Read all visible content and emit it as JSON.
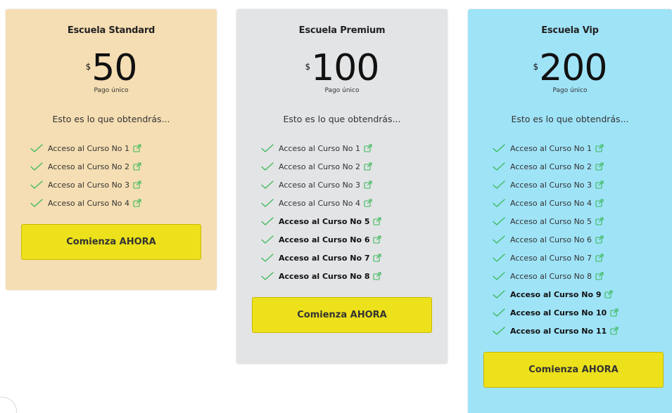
{
  "plans": [
    {
      "key": "standard",
      "title": "Escuela Standard",
      "currency": "$",
      "price": "50",
      "price_note": "Pago único",
      "subtitle": "Esto es lo que obtendrás...",
      "features": [
        {
          "label": "Acceso al Curso No 1",
          "bold": false
        },
        {
          "label": "Acceso al Curso No 2",
          "bold": false
        },
        {
          "label": "Acceso al Curso No 3",
          "bold": false
        },
        {
          "label": "Acceso al Curso No 4",
          "bold": false
        }
      ],
      "cta_label": "Comienza AHORA"
    },
    {
      "key": "premium",
      "title": "Escuela Premium",
      "currency": "$",
      "price": "100",
      "price_note": "Pago único",
      "subtitle": "Esto es lo que obtendrás...",
      "features": [
        {
          "label": "Acceso al Curso No 1",
          "bold": false
        },
        {
          "label": "Acceso al Curso No 2",
          "bold": false
        },
        {
          "label": "Acceso al Curso No 3",
          "bold": false
        },
        {
          "label": "Acceso al Curso No 4",
          "bold": false
        },
        {
          "label": "Acceso al Curso No 5",
          "bold": true
        },
        {
          "label": "Acceso al Curso No 6",
          "bold": true
        },
        {
          "label": "Acceso al Curso No 7",
          "bold": true
        },
        {
          "label": "Acceso al Curso No 8",
          "bold": true
        }
      ],
      "cta_label": "Comienza AHORA"
    },
    {
      "key": "vip",
      "title": "Escuela Vip",
      "currency": "$",
      "price": "200",
      "price_note": "Pago único",
      "subtitle": "Esto es lo que obtendrás...",
      "features": [
        {
          "label": "Acceso al Curso No 1",
          "bold": false
        },
        {
          "label": "Acceso al Curso No 2",
          "bold": false
        },
        {
          "label": "Acceso al Curso No 3",
          "bold": false
        },
        {
          "label": "Acceso al Curso No 4",
          "bold": false
        },
        {
          "label": "Acceso al Curso No 5",
          "bold": false
        },
        {
          "label": "Acceso al Curso No 6",
          "bold": false
        },
        {
          "label": "Acceso al Curso No 7",
          "bold": false
        },
        {
          "label": "Acceso al Curso No 8",
          "bold": false
        },
        {
          "label": "Acceso al Curso No 9",
          "bold": true
        },
        {
          "label": "Acceso al Curso No 10",
          "bold": true
        },
        {
          "label": "Acceso al Curso No 11",
          "bold": true
        }
      ],
      "cta_label": "Comienza AHORA"
    }
  ],
  "icons": {
    "check": "check-icon",
    "link": "external-link-icon"
  },
  "colors": {
    "standard_bg": "#f5deb3",
    "premium_bg": "#e3e4e6",
    "vip_bg": "#9fe3f7",
    "cta_bg": "#ede11b",
    "check": "#3cb95a",
    "link": "#3cb95a"
  }
}
